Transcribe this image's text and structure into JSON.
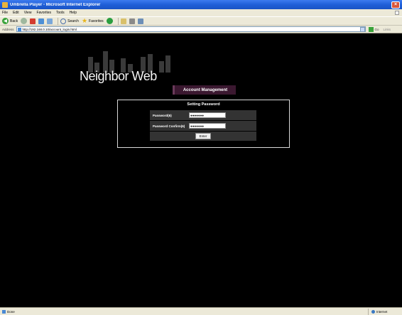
{
  "window": {
    "title": "Umbrella Player - Microsoft Internet Explorer",
    "close_glyph": "×"
  },
  "menu": [
    "File",
    "Edit",
    "View",
    "Favorites",
    "Tools",
    "Help"
  ],
  "toolbar": {
    "back_label": "Back",
    "back_glyph": "◀",
    "search_label": "Search",
    "favorites_label": "Favorites"
  },
  "address": {
    "label": "Address",
    "url": "http://192.168.0.10/account_login.html",
    "go_label": "Go",
    "links_label": "Links"
  },
  "page": {
    "logo_text": "Neighbor Web",
    "section_label": "Account Management",
    "panel_title": "Setting Password",
    "fields": [
      {
        "label": "Password(6)",
        "value": "●●●●●●●"
      },
      {
        "label": "Password Confirm(6)",
        "value": "●●●●●●●"
      }
    ],
    "enter_label": "Enter"
  },
  "status": {
    "text": "Done",
    "zone": "Internet"
  }
}
